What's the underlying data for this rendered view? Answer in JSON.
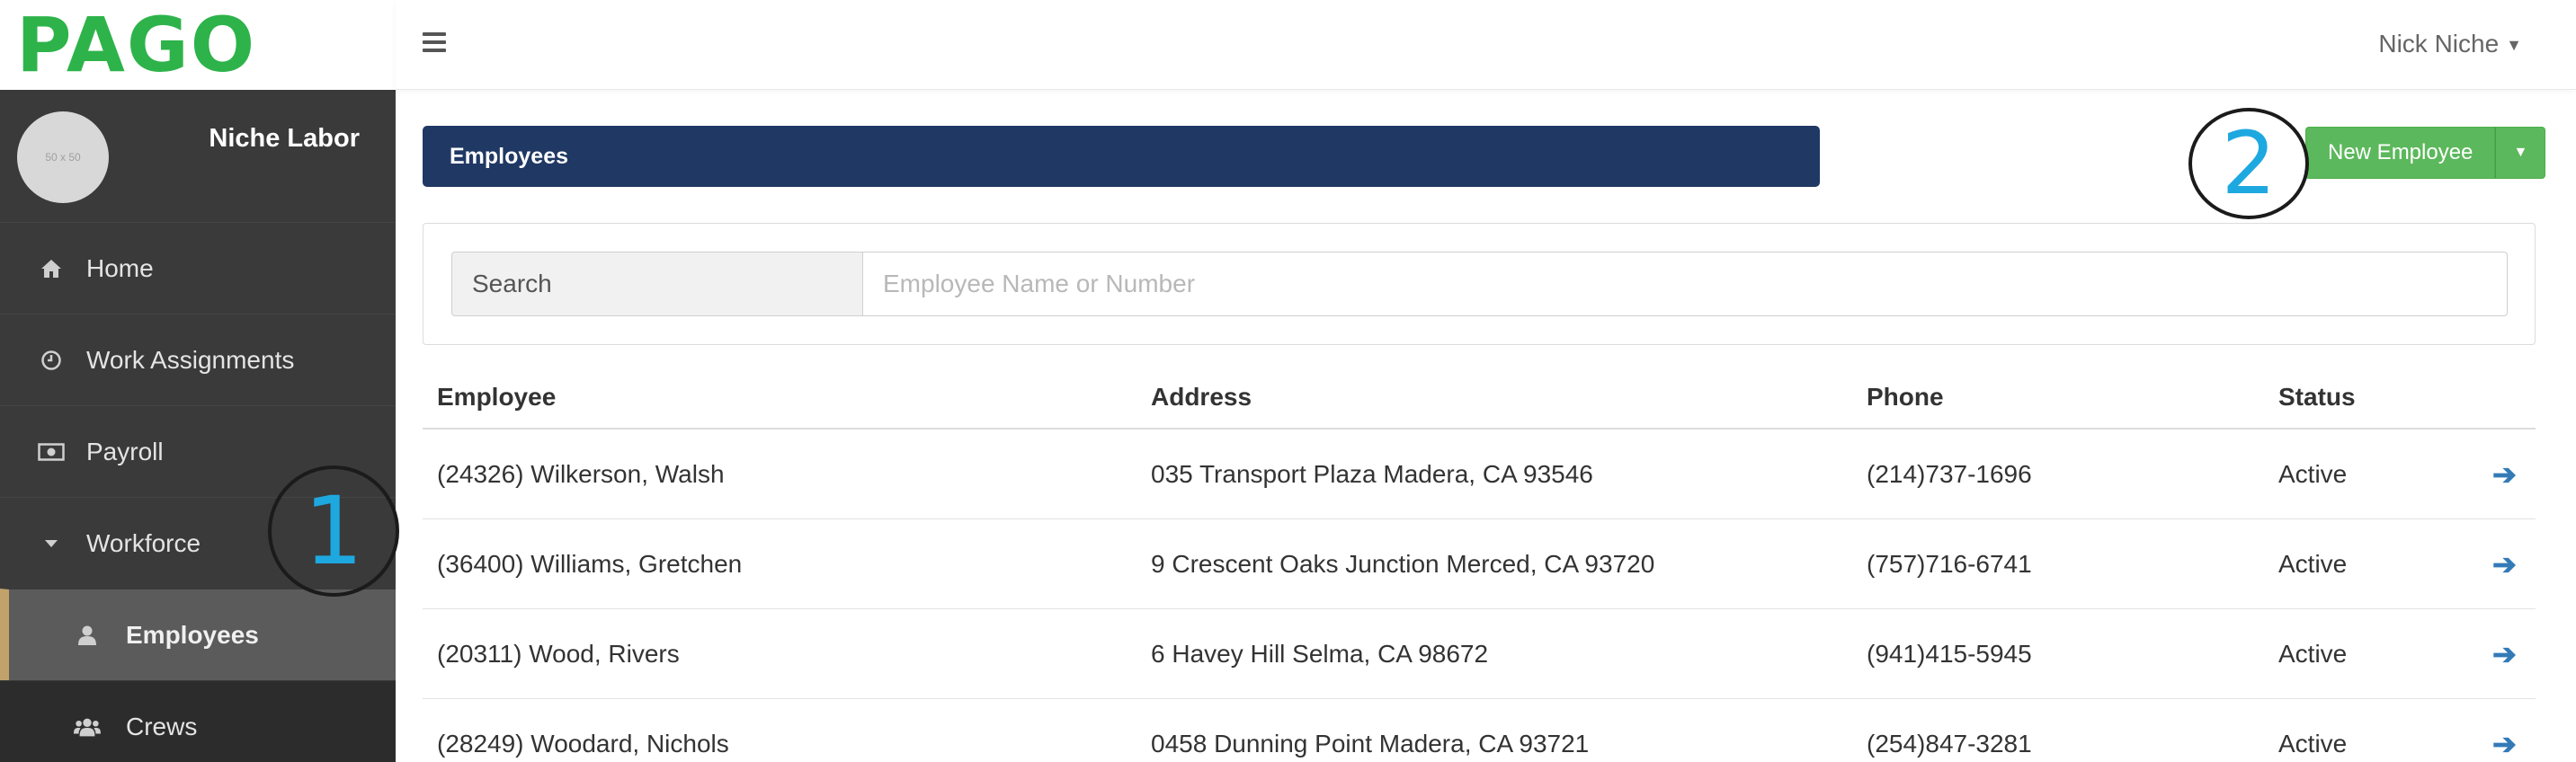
{
  "app": {
    "logo": "PAGO",
    "company": "Niche Labor",
    "avatar_placeholder": "50 x 50"
  },
  "sidebar": {
    "items": [
      {
        "label": "Home",
        "icon": "home-icon"
      },
      {
        "label": "Work Assignments",
        "icon": "clock-icon"
      },
      {
        "label": "Payroll",
        "icon": "money-icon"
      },
      {
        "label": "Workforce",
        "icon": "caret-down-icon"
      },
      {
        "label": "Employees",
        "icon": "user-icon"
      },
      {
        "label": "Crews",
        "icon": "users-icon"
      }
    ]
  },
  "header": {
    "user": "Nick Niche"
  },
  "page": {
    "title": "Employees",
    "new_button": "New Employee"
  },
  "markers": {
    "one": "1",
    "two": "2"
  },
  "search": {
    "label": "Search",
    "placeholder": "Employee Name or Number"
  },
  "table": {
    "headers": {
      "employee": "Employee",
      "address": "Address",
      "phone": "Phone",
      "status": "Status"
    },
    "rows": [
      {
        "employee": "(24326) Wilkerson, Walsh",
        "address": "035 Transport Plaza Madera, CA 93546",
        "phone": "(214)737-1696",
        "status": "Active"
      },
      {
        "employee": "(36400) Williams, Gretchen",
        "address": "9 Crescent Oaks Junction Merced, CA 93720",
        "phone": "(757)716-6741",
        "status": "Active"
      },
      {
        "employee": "(20311) Wood, Rivers",
        "address": "6 Havey Hill Selma, CA 98672",
        "phone": "(941)415-5945",
        "status": "Active"
      },
      {
        "employee": "(28249) Woodard, Nichols",
        "address": "0458 Dunning Point Madera, CA 93721",
        "phone": "(254)847-3281",
        "status": "Active"
      }
    ]
  },
  "colors": {
    "brand_green": "#2db34a",
    "banner_navy": "#203864",
    "button_green": "#5cb85c",
    "link_blue": "#337ab7",
    "active_accent": "#c2a26b",
    "marker_blue": "#1ea8e0"
  }
}
